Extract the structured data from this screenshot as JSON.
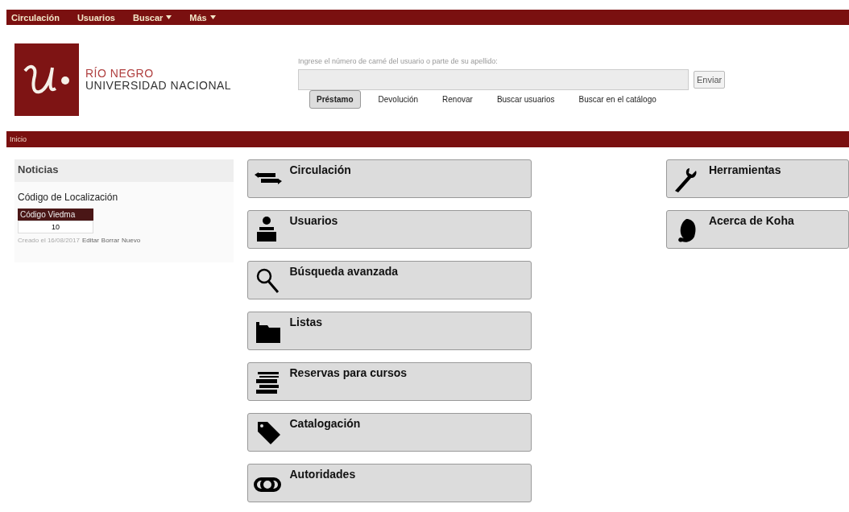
{
  "top_nav": [
    {
      "label": "Circulación",
      "dropdown": false
    },
    {
      "label": "Usuarios",
      "dropdown": false
    },
    {
      "label": "Buscar",
      "dropdown": true
    },
    {
      "label": "Más",
      "dropdown": true
    }
  ],
  "logo": {
    "line_1": "RÍO NEGRO",
    "line_2": "UNIVERSIDAD NACIONAL"
  },
  "checkout": {
    "label": "Ingrese el número de carné del usuario o parte de su apellido:",
    "button": "Enviar"
  },
  "tabs": [
    {
      "label": "Préstamo",
      "selected": true
    },
    {
      "label": "Devolución",
      "selected": false
    },
    {
      "label": "Renovar",
      "selected": false
    },
    {
      "label": "Buscar usuarios",
      "selected": false
    },
    {
      "label": "Buscar en el catálogo",
      "selected": false
    }
  ],
  "breadcrumb": "Inicio",
  "news": {
    "title": "Noticias",
    "item_title": "Código de Localización",
    "table_header": "Código Viedma",
    "table_cell": "10",
    "posted": "Creado el 16/08/2017",
    "links": [
      "Editar",
      "Borrar",
      "Nuevo"
    ]
  },
  "main_modules": [
    {
      "label": "Circulación",
      "kind": "circulation"
    },
    {
      "label": "Usuarios",
      "kind": "patrons"
    },
    {
      "label": "Búsqueda avanzada",
      "kind": "search"
    },
    {
      "label": "Listas",
      "kind": "lists"
    },
    {
      "label": "Reservas para cursos",
      "kind": "books"
    },
    {
      "label": "Catalogación",
      "kind": "tag"
    },
    {
      "label": "Autoridades",
      "kind": "link"
    }
  ],
  "side_modules": [
    {
      "label": "Herramientas",
      "kind": "tools"
    },
    {
      "label": "Acerca de Koha",
      "kind": "koha"
    }
  ]
}
